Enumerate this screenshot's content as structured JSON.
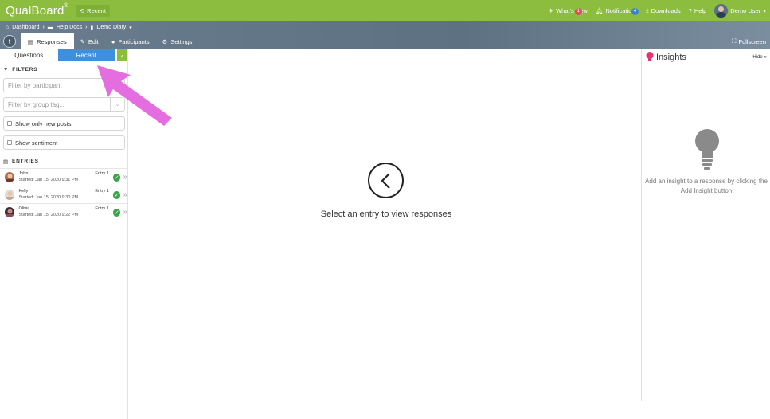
{
  "topbar": {
    "logo": "QualBoard",
    "logo_mark": "®",
    "recent": "Recent",
    "whats_new": "What's New",
    "whats_new_badge": "1",
    "notifications": "Notifications",
    "notifications_badge": "4",
    "downloads": "Downloads",
    "help": "Help",
    "user": "Demo User"
  },
  "breadcrumb": {
    "items": [
      "Dashboard",
      "Help Docs",
      "Demo Diary"
    ]
  },
  "tabs": {
    "logo_letter": "t",
    "responses": "Responses",
    "edit": "Edit",
    "participants": "Participants",
    "settings": "Settings",
    "fullscreen": "Fullscreen"
  },
  "sidebar": {
    "tab_questions": "Questions",
    "tab_recent": "Recent",
    "filters_heading": "FILTERS",
    "participant_placeholder": "Filter by participant",
    "group_placeholder": "Filter by group tag...",
    "show_new_posts": "Show only new posts",
    "show_sentiment": "Show sentiment",
    "entries_heading": "ENTRIES",
    "entries": [
      {
        "name": "John",
        "entry": "Entry 1",
        "started": "Started: Jan 15, 2020 9:31 PM"
      },
      {
        "name": "Kelly",
        "entry": "Entry 1",
        "started": "Started: Jan 15, 2020 9:30 PM"
      },
      {
        "name": "Olivia",
        "entry": "Entry 1",
        "started": "Started: Jan 15, 2020 9:22 PM"
      }
    ]
  },
  "main": {
    "message": "Select an entry to view responses"
  },
  "insights": {
    "title": "Insights",
    "hide": "Hide",
    "message": "Add an insight to a response by clicking the Add Insight button"
  },
  "colors": {
    "brand_green": "#8cbd3f",
    "active_blue": "#3e8fdc",
    "subbar": "#5d7183",
    "highlight_arrow": "#e46ee0",
    "insight_pink": "#e8336f"
  }
}
